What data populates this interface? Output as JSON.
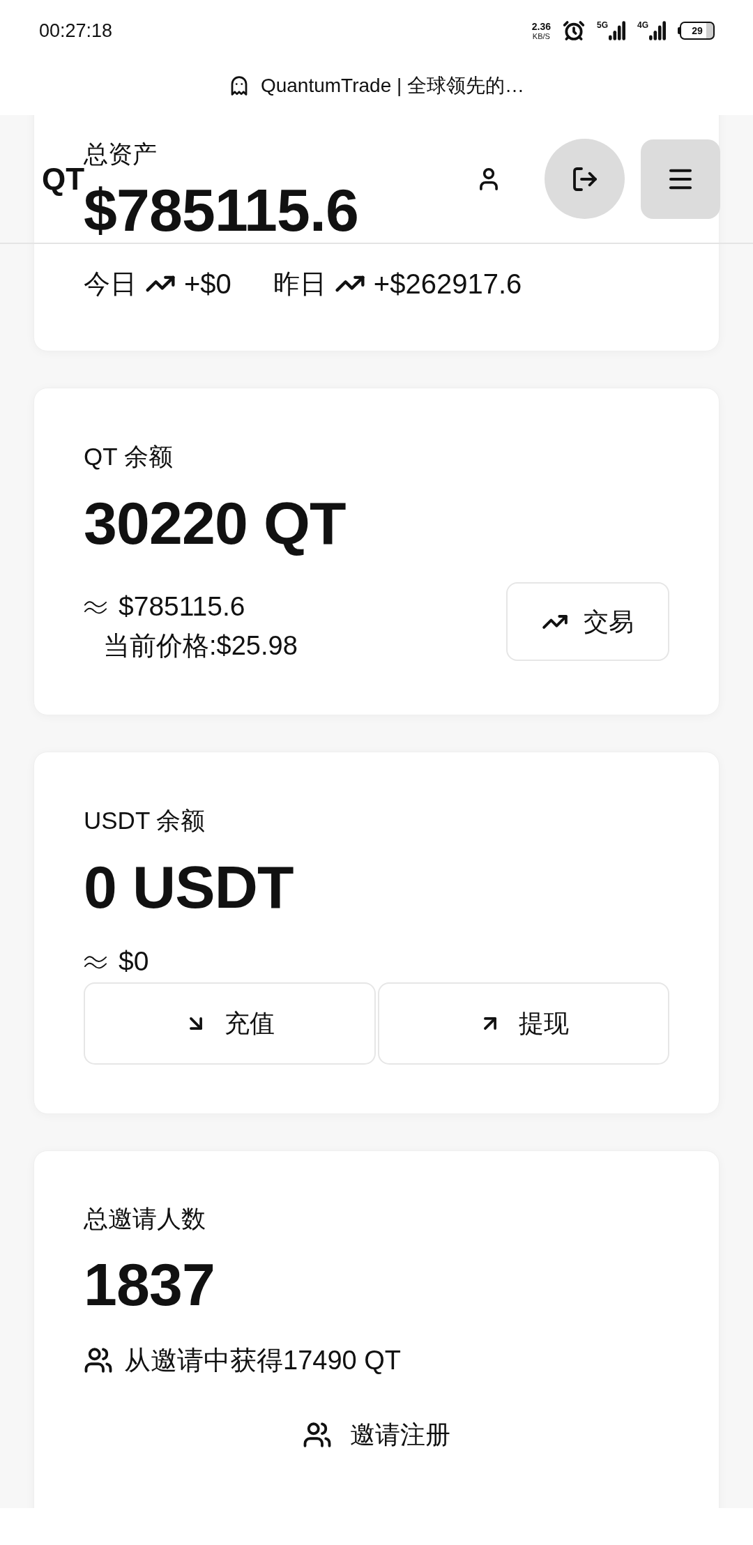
{
  "status_bar": {
    "time": "00:27:18",
    "net_speed": "2.36",
    "net_speed_unit": "KB/S",
    "networks": [
      {
        "label": "5G"
      },
      {
        "label": "4G"
      }
    ],
    "battery": "29"
  },
  "title_bar": {
    "title": "QuantumTrade | 全球领先的…"
  },
  "header": {
    "logo": "QT"
  },
  "total_assets": {
    "label": "总资产",
    "value": "$785115.6",
    "changes": [
      {
        "label": "今日",
        "value": "+$0"
      },
      {
        "label": "昨日",
        "value": "+$262917.6"
      }
    ]
  },
  "balances": [
    {
      "kind": "inline",
      "label": "QT 余额",
      "amount": "30220 QT",
      "approx": "$785115.6",
      "price": "当前价格:$25.98",
      "actions": [
        {
          "kind": "trade",
          "label": "交易"
        }
      ]
    },
    {
      "kind": "row",
      "label": "USDT 余额",
      "amount": "0 USDT",
      "approx": "$0",
      "actions": [
        {
          "kind": "deposit",
          "label": "充值"
        },
        {
          "kind": "withdraw",
          "label": "提现"
        }
      ]
    }
  ],
  "invites": {
    "label": "总邀请人数",
    "count": "1837",
    "earned": "从邀请中获得17490 QT",
    "button": "邀请注册"
  }
}
